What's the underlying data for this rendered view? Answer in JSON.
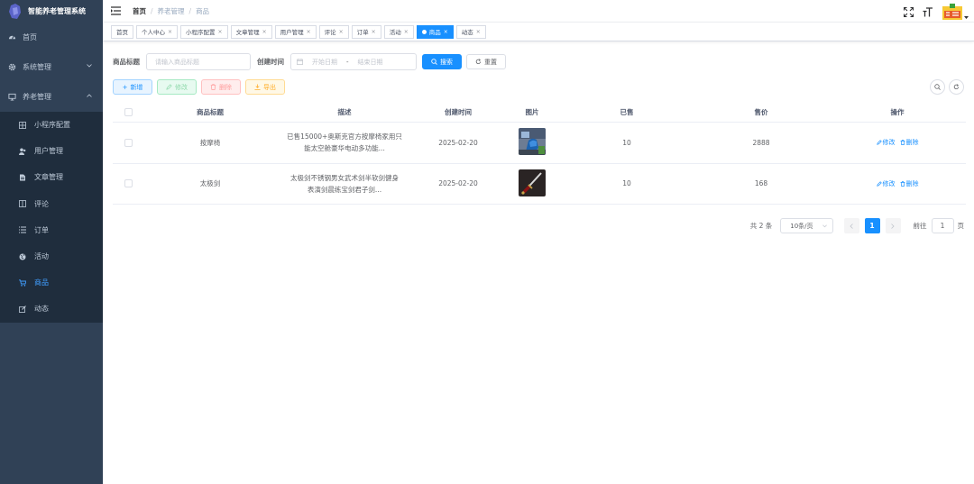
{
  "app": {
    "title": "智能养老管理系统"
  },
  "sidebar": {
    "items": [
      {
        "label": "首页",
        "icon": "dashboard-icon"
      },
      {
        "label": "系统管理",
        "icon": "gear-icon"
      },
      {
        "label": "养老管理",
        "icon": "monitor-icon"
      }
    ],
    "sub_items": [
      {
        "label": "小程序配置",
        "icon": "grid-icon"
      },
      {
        "label": "用户管理",
        "icon": "user-icon"
      },
      {
        "label": "文章管理",
        "icon": "document-icon"
      },
      {
        "label": "评论",
        "icon": "book-icon"
      },
      {
        "label": "订单",
        "icon": "list-icon"
      },
      {
        "label": "活动",
        "icon": "globe-icon"
      },
      {
        "label": "商品",
        "icon": "cart-icon"
      },
      {
        "label": "动态",
        "icon": "edit-icon"
      }
    ]
  },
  "breadcrumb": [
    "首页",
    "养老管理",
    "商品"
  ],
  "tags": [
    {
      "label": "首页"
    },
    {
      "label": "个人中心"
    },
    {
      "label": "小程序配置"
    },
    {
      "label": "文章管理"
    },
    {
      "label": "用户管理"
    },
    {
      "label": "评论"
    },
    {
      "label": "订单"
    },
    {
      "label": "活动"
    },
    {
      "label": "商品"
    },
    {
      "label": "动态"
    }
  ],
  "search": {
    "title_label": "商品标题",
    "title_placeholder": "请输入商品标题",
    "time_label": "创建时间",
    "start_placeholder": "开始日期",
    "range_sep": "-",
    "end_placeholder": "结束日期",
    "search_btn": "搜索",
    "reset_btn": "重置"
  },
  "toolbar": {
    "add": "新增",
    "edit": "修改",
    "delete": "删除",
    "export": "导出"
  },
  "table": {
    "headers": [
      "商品标题",
      "描述",
      "创建时间",
      "图片",
      "已售",
      "售价",
      "操作"
    ],
    "rows": [
      {
        "title": "按摩椅",
        "desc1": "已售15000+奥斯克官方按摩椅家用只",
        "desc2": "能太空舱豪华电动多功能...",
        "created": "2025-02-20",
        "sold": "10",
        "price": "2888",
        "edit": "修改",
        "delete": "删除"
      },
      {
        "title": "太极剑",
        "desc1": "太极剑不锈钢男女武术剑半软剑健身",
        "desc2": "表演剑晨练宝剑君子剑...",
        "created": "2025-02-20",
        "sold": "10",
        "price": "168",
        "edit": "修改",
        "delete": "删除"
      }
    ]
  },
  "pagination": {
    "total": "共 2 条",
    "page_size": "10条/页",
    "current": "1",
    "goto_label": "前往",
    "goto_value": "1",
    "page_unit": "页"
  },
  "colors": {
    "sidebar_bg": "#304156",
    "submenu_bg": "#1f2d3d",
    "primary": "#1890ff"
  }
}
